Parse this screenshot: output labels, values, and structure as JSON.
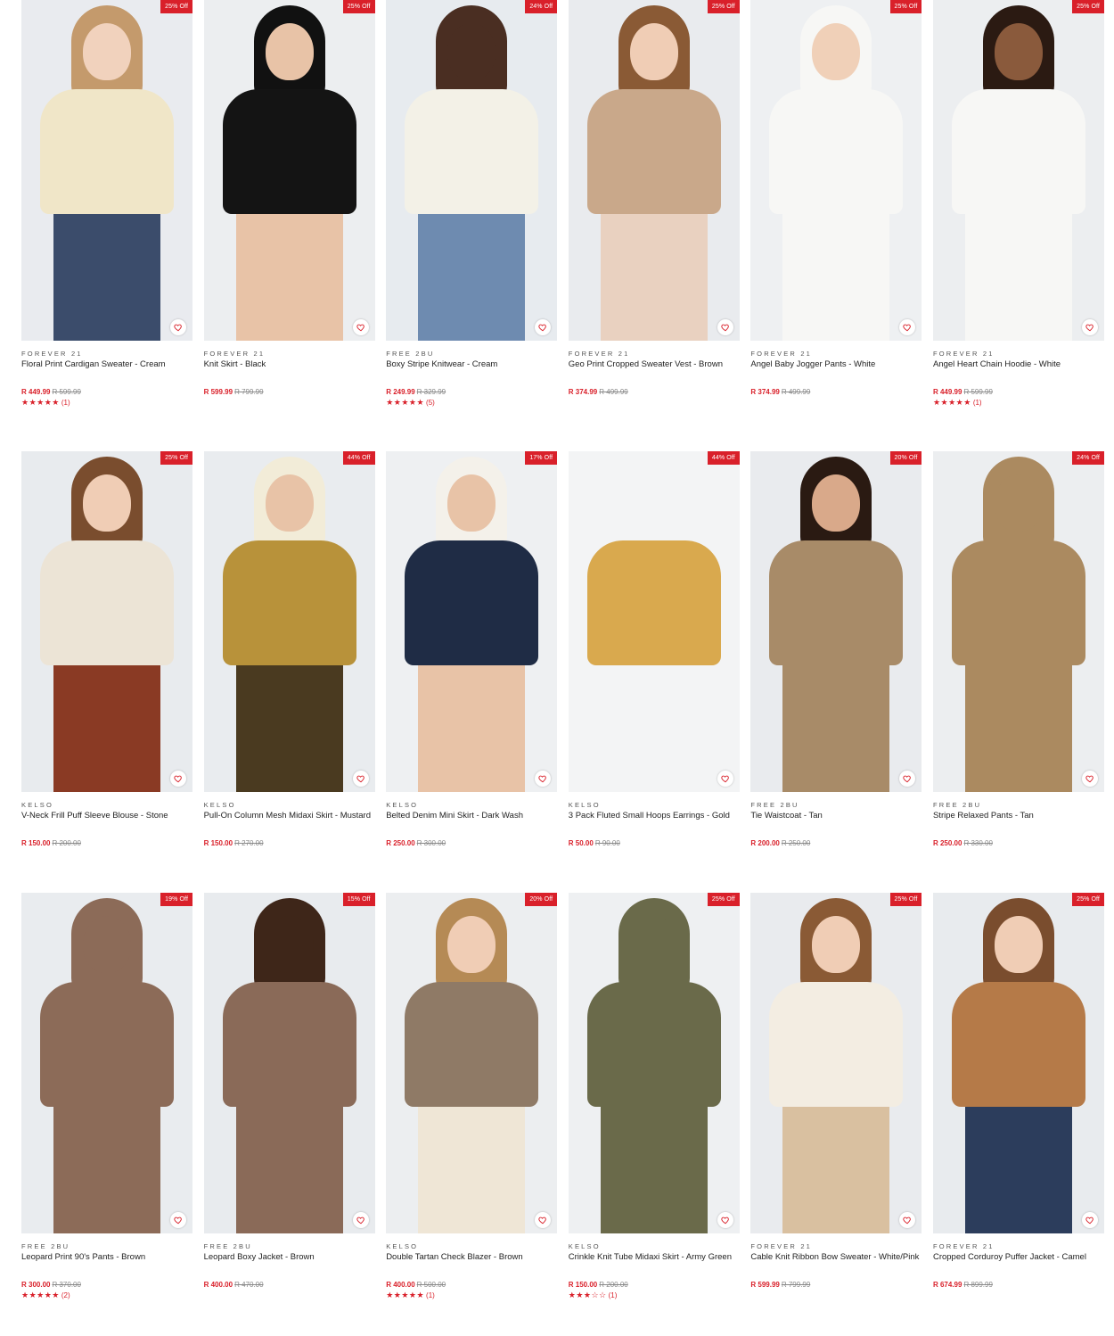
{
  "colors": {
    "accent": "#d9202a",
    "muted": "#888888"
  },
  "products": [
    {
      "brand": "FOREVER 21",
      "name": "Floral Print Cardigan Sweater - Cream",
      "price": "R 449.99",
      "was": "R 599.99",
      "badge": "25% Off",
      "stars": "★★★★★",
      "count": "(1)",
      "bg": "#e9ebef",
      "tone": "#f0e6c8",
      "skin": "#f1d2bd",
      "hair": "#c49a6c",
      "bottom": "#3b4c6b"
    },
    {
      "brand": "FOREVER 21",
      "name": "Knit Skirt - Black",
      "price": "R 599.99",
      "was": "R 799.99",
      "badge": "25% Off",
      "stars": "",
      "count": "",
      "bg": "#eceef0",
      "tone": "#141414",
      "skin": "#e8c3a7",
      "hair": "#111111",
      "bottom": "#e8c3a7"
    },
    {
      "brand": "FREE 2BU",
      "name": "Boxy Stripe Knitwear - Cream",
      "price": "R 249.99",
      "was": "R 329.99",
      "badge": "24% Off",
      "stars": "★★★★★",
      "count": "(5)",
      "bg": "#e7ebef",
      "tone": "#f3f1e7",
      "skin": "#4a2e22",
      "hair": "#4a2e22",
      "bottom": "#6e8bb0"
    },
    {
      "brand": "FOREVER 21",
      "name": "Geo Print Cropped Sweater Vest - Brown",
      "price": "R 374.99",
      "was": "R 499.99",
      "badge": "25% Off",
      "stars": "",
      "count": "",
      "bg": "#e9ebee",
      "tone": "#c9a88a",
      "skin": "#f0cdb5",
      "hair": "#8a5a35",
      "bottom": "#e9d1c0"
    },
    {
      "brand": "FOREVER 21",
      "name": "Angel Baby Jogger Pants - White",
      "price": "R 374.99",
      "was": "R 499.99",
      "badge": "25% Off",
      "stars": "",
      "count": "",
      "bg": "#eef0f2",
      "tone": "#f7f7f5",
      "skin": "#f0d0b8",
      "hair": "#f7f7f5",
      "bottom": "#f7f7f5"
    },
    {
      "brand": "FOREVER 21",
      "name": "Angel Heart Chain Hoodie - White",
      "price": "R 449.99",
      "was": "R 599.99",
      "badge": "25% Off",
      "stars": "★★★★★",
      "count": "(1)",
      "bg": "#eceef0",
      "tone": "#f7f7f5",
      "skin": "#8a5a3c",
      "hair": "#2b1a12",
      "bottom": "#f7f7f5"
    },
    {
      "brand": "KELSO",
      "name": "V-Neck Frill Puff Sleeve Blouse - Stone",
      "price": "R 150.00",
      "was": "R 200.00",
      "badge": "25% Off",
      "stars": "",
      "count": "",
      "bg": "#e8ebee",
      "tone": "#ece4d6",
      "skin": "#f0cdb5",
      "hair": "#7a4d2e",
      "bottom": "#8a3a24"
    },
    {
      "brand": "KELSO",
      "name": "Pull-On Column Mesh Midaxi Skirt - Mustard",
      "price": "R 150.00",
      "was": "R 270.00",
      "badge": "44% Off",
      "stars": "",
      "count": "",
      "bg": "#e9ecef",
      "tone": "#b8923a",
      "skin": "#e8c3a7",
      "hair": "#f2ecd8",
      "bottom": "#4a3a20"
    },
    {
      "brand": "KELSO",
      "name": "Belted Denim Mini Skirt - Dark Wash",
      "price": "R 250.00",
      "was": "R 300.00",
      "badge": "17% Off",
      "stars": "",
      "count": "",
      "bg": "#eef0f2",
      "tone": "#1f2c45",
      "skin": "#e8c3a7",
      "hair": "#f4f1ea",
      "bottom": "#e8c3a7"
    },
    {
      "brand": "KELSO",
      "name": "3 Pack Fluted Small Hoops Earrings - Gold",
      "price": "R 50.00",
      "was": "R 90.00",
      "badge": "44% Off",
      "stars": "",
      "count": "",
      "bg": "#f3f4f5",
      "tone": "#d9a94e",
      "skin": "#f3f4f5",
      "hair": "#f3f4f5",
      "bottom": "#f3f4f5"
    },
    {
      "brand": "FREE 2BU",
      "name": "Tie Waistcoat - Tan",
      "price": "R 200.00",
      "was": "R 250.00",
      "badge": "20% Off",
      "stars": "",
      "count": "",
      "bg": "#e9ebee",
      "tone": "#a88b68",
      "skin": "#d9a98a",
      "hair": "#2a1a12",
      "bottom": "#a88b68"
    },
    {
      "brand": "FREE 2BU",
      "name": "Stripe Relaxed Pants - Tan",
      "price": "R 250.00",
      "was": "R 330.00",
      "badge": "24% Off",
      "stars": "",
      "count": "",
      "bg": "#eceef0",
      "tone": "#ab8a60",
      "skin": "#ab8a60",
      "hair": "#ab8a60",
      "bottom": "#ab8a60"
    },
    {
      "brand": "FREE 2BU",
      "name": "Leopard Print 90's Pants - Brown",
      "price": "R 300.00",
      "was": "R 370.00",
      "badge": "19% Off",
      "stars": "★★★★★",
      "count": "(2)",
      "bg": "#e9ecef",
      "tone": "#8c6b58",
      "skin": "#8c6b58",
      "hair": "#8c6b58",
      "bottom": "#8c6b58"
    },
    {
      "brand": "FREE 2BU",
      "name": "Leopard Boxy Jacket - Brown",
      "price": "R 400.00",
      "was": "R 470.00",
      "badge": "15% Off",
      "stars": "",
      "count": "",
      "bg": "#e8ebee",
      "tone": "#8a6a58",
      "skin": "#3e2619",
      "hair": "#3e2619",
      "bottom": "#8a6a58"
    },
    {
      "brand": "KELSO",
      "name": "Double Tartan Check Blazer - Brown",
      "price": "R 400.00",
      "was": "R 500.00",
      "badge": "20% Off",
      "stars": "★★★★★",
      "count": "(1)",
      "bg": "#eceef0",
      "tone": "#8f7a66",
      "skin": "#f0cdb5",
      "hair": "#b58a55",
      "bottom": "#efe6d6"
    },
    {
      "brand": "KELSO",
      "name": "Crinkle Knit Tube Midaxi Skirt - Army Green",
      "price": "R 150.00",
      "was": "R 200.00",
      "badge": "25% Off",
      "stars": "★★★☆☆",
      "count": "(1)",
      "bg": "#eef0f2",
      "tone": "#6a6a4a",
      "skin": "#6a6a4a",
      "hair": "#6a6a4a",
      "bottom": "#6a6a4a"
    },
    {
      "brand": "FOREVER 21",
      "name": "Cable Knit Ribbon Bow Sweater - White/Pink",
      "price": "R 599.99",
      "was": "R 799.99",
      "badge": "25% Off",
      "stars": "",
      "count": "",
      "bg": "#e9ebee",
      "tone": "#f3ede2",
      "skin": "#f0cdb5",
      "hair": "#8a5a35",
      "bottom": "#d9c0a0"
    },
    {
      "brand": "FOREVER 21",
      "name": "Cropped Corduroy Puffer Jacket - Camel",
      "price": "R 674.99",
      "was": "R 899.99",
      "badge": "25% Off",
      "stars": "",
      "count": "",
      "bg": "#e8ebee",
      "tone": "#b57a48",
      "skin": "#f0cdb5",
      "hair": "#7a4d2e",
      "bottom": "#2c3d5c"
    }
  ]
}
